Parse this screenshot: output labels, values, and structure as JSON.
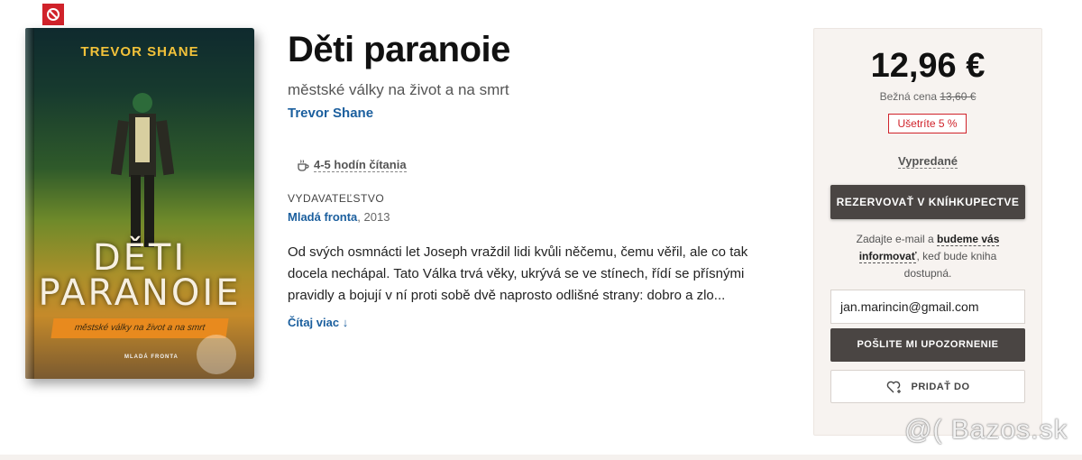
{
  "book": {
    "title": "Děti paranoie",
    "subtitle": "městské války na život a na smrt",
    "author": "Trevor Shane",
    "reading_time": "4-5 hodín čítania",
    "publisher_heading": "VYDAVATEĽSTVO",
    "publisher": "Mladá fronta",
    "year": ", 2013",
    "description": "Od svých osmnácti let Joseph vraždil lidi kvůli něčemu, čemu věřil, ale co tak docela nechápal. Tato Válka trvá věky, ukrývá se ve stínech, řídí se přísnými pravidly a bojují v ní proti sobě dvě naprosto odlišné strany: dobro a zlo...",
    "read_more": "Čítaj viac ↓"
  },
  "cover": {
    "author": "TREVOR SHANE",
    "title_line1": "DĚTI",
    "title_line2": "PARANOIE",
    "band": "městské války na život a na smrt",
    "publisher": "MLADÁ FRONTA"
  },
  "purchase": {
    "price": "12,96 €",
    "regular_label": "Bežná cena",
    "regular_price": "13,60 €",
    "save_label": "Ušetríte 5 %",
    "availability": "Vypredané",
    "reserve_button": "REZERVOVAŤ V KNÍHKUPECTVE",
    "notify_prefix": "Zadajte e-mail a ",
    "notify_bold": "budeme vás informovať",
    "notify_suffix": ", keď bude kniha dostupná.",
    "email_value": "jan.marincin@gmail.com",
    "send_button": "POŠLITE MI UPOZORNENIE",
    "add_button": "PRIDAŤ DO"
  },
  "watermark": "@( Bazos.sk",
  "colors": {
    "accent_blue": "#1b5f9e",
    "sale_red": "#d0222a",
    "button_dark": "#4a4543"
  },
  "icons": {
    "top_badge": "no-symbol-icon",
    "reading": "coffee-cup-icon",
    "add": "heart-plus-icon"
  }
}
